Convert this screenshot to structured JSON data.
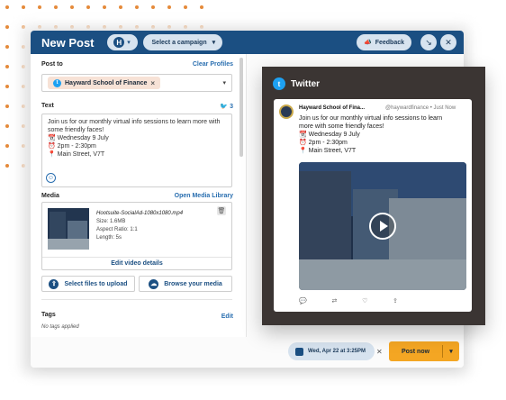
{
  "colors": {
    "topbar": "#1b4f82",
    "accent": "#2a6fb0",
    "post_button": "#f4a623",
    "preview_bg": "#3b3533",
    "twitter": "#1da1f2",
    "dots": "#e58a3a"
  },
  "header": {
    "title": "New Post",
    "account_initial": "H",
    "campaign_label": "Select a campaign",
    "feedback_label": "Feedback",
    "icons": [
      "megaphone-icon",
      "minimize-icon",
      "close-icon"
    ]
  },
  "post_to": {
    "label": "Post to",
    "clear_label": "Clear Profiles",
    "profile": "Hayward School of Finance"
  },
  "text": {
    "label": "Text",
    "count": "3",
    "lines": [
      "Join us for our monthly virtual info sessions to learn more with",
      "some friendly faces!",
      "📆 Wednesday 9 July",
      "⏰ 2pm - 2:30pm",
      "📍 Main Street, V7T"
    ]
  },
  "media": {
    "label": "Media",
    "library_label": "Open Media Library",
    "filename": "Hootsuite-SocialAd-1080x1080.mp4",
    "size": "Size: 1.6MB",
    "aspect": "Aspect Ratio: 1:1",
    "length": "Length: 5s",
    "edit_label": "Edit video details",
    "upload_label": "Select files to upload",
    "browse_label": "Browse your media"
  },
  "tags": {
    "label": "Tags",
    "edit_label": "Edit",
    "empty_text": "No tags applied"
  },
  "footer": {
    "date": "Wed, Apr 22 at 3:25PM",
    "post_label": "Post now"
  },
  "preview": {
    "network": "Twitter",
    "name": "Hayward School of Fina...",
    "handle": "@haywardfinance • Just Now",
    "lines": [
      "Join us for our monthly virtual info sessions to learn",
      "more with some friendly faces!",
      "📆 Wednesday 9 July",
      "⏰ 2pm - 2:30pm",
      "📍 Main Street, V7T"
    ]
  }
}
